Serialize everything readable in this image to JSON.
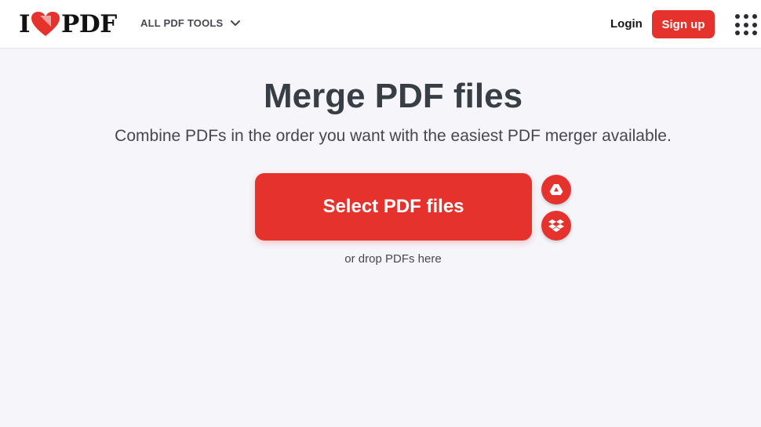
{
  "header": {
    "logo": {
      "left_text": "I",
      "right_text": "PDF",
      "heart_icon": "heart-icon"
    },
    "tools_menu_label": "ALL PDF TOOLS",
    "login_label": "Login",
    "signup_label": "Sign up",
    "apps_icon": "apps-grid-icon"
  },
  "main": {
    "title": "Merge PDF files",
    "subtitle": "Combine PDFs in the order you want with the easiest PDF merger available.",
    "select_button_label": "Select PDF files",
    "cloud_buttons": [
      "google-drive-icon",
      "dropbox-icon"
    ],
    "drop_hint": "or drop PDFs here"
  },
  "colors": {
    "accent": "#e5322d",
    "background": "#f5f5fa",
    "header_bg": "#ffffff",
    "title_text": "#383e45"
  }
}
